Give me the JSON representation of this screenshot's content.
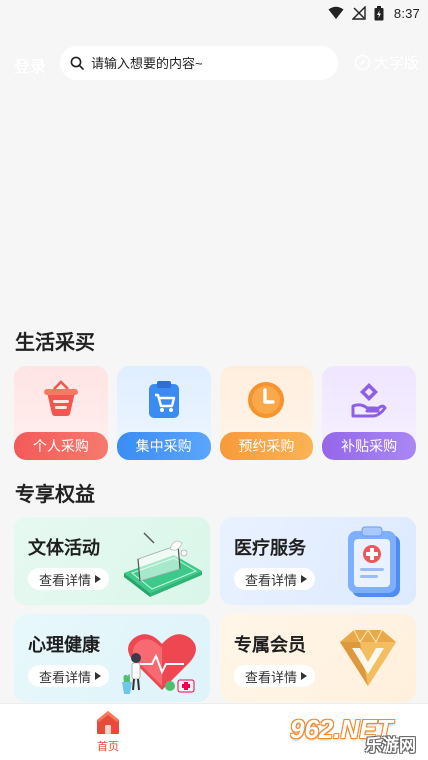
{
  "status_bar": {
    "time": "8:37"
  },
  "header": {
    "login_label": "登录",
    "search_placeholder": "请输入想要的内容~",
    "font_size_label": "大字版"
  },
  "sections": {
    "life_shopping_title": "生活采买",
    "benefits_title": "专享权益"
  },
  "quick_actions": [
    {
      "label": "个人采购",
      "icon": "basket-icon",
      "color": "#f35a5a"
    },
    {
      "label": "集中采购",
      "icon": "cart-clipboard-icon",
      "color": "#3b8cf4"
    },
    {
      "label": "预约采购",
      "icon": "clock-icon",
      "color": "#f79a3a"
    },
    {
      "label": "补贴采购",
      "icon": "subsidy-hand-icon",
      "color": "#9467ea"
    }
  ],
  "benefits": [
    {
      "title": "文体活动",
      "button": "查看详情",
      "art": "badminton-court-illustration"
    },
    {
      "title": "医疗服务",
      "button": "查看详情",
      "art": "medical-clipboard-illustration"
    },
    {
      "title": "心理健康",
      "button": "查看详情",
      "art": "heart-person-illustration"
    },
    {
      "title": "专属会员",
      "button": "查看详情",
      "art": "diamond-v-illustration"
    }
  ],
  "bottom_nav": {
    "home_label": "首页",
    "accent": "#e24a3b"
  },
  "watermark": {
    "brand": "962.NET",
    "sub": "乐游网"
  }
}
